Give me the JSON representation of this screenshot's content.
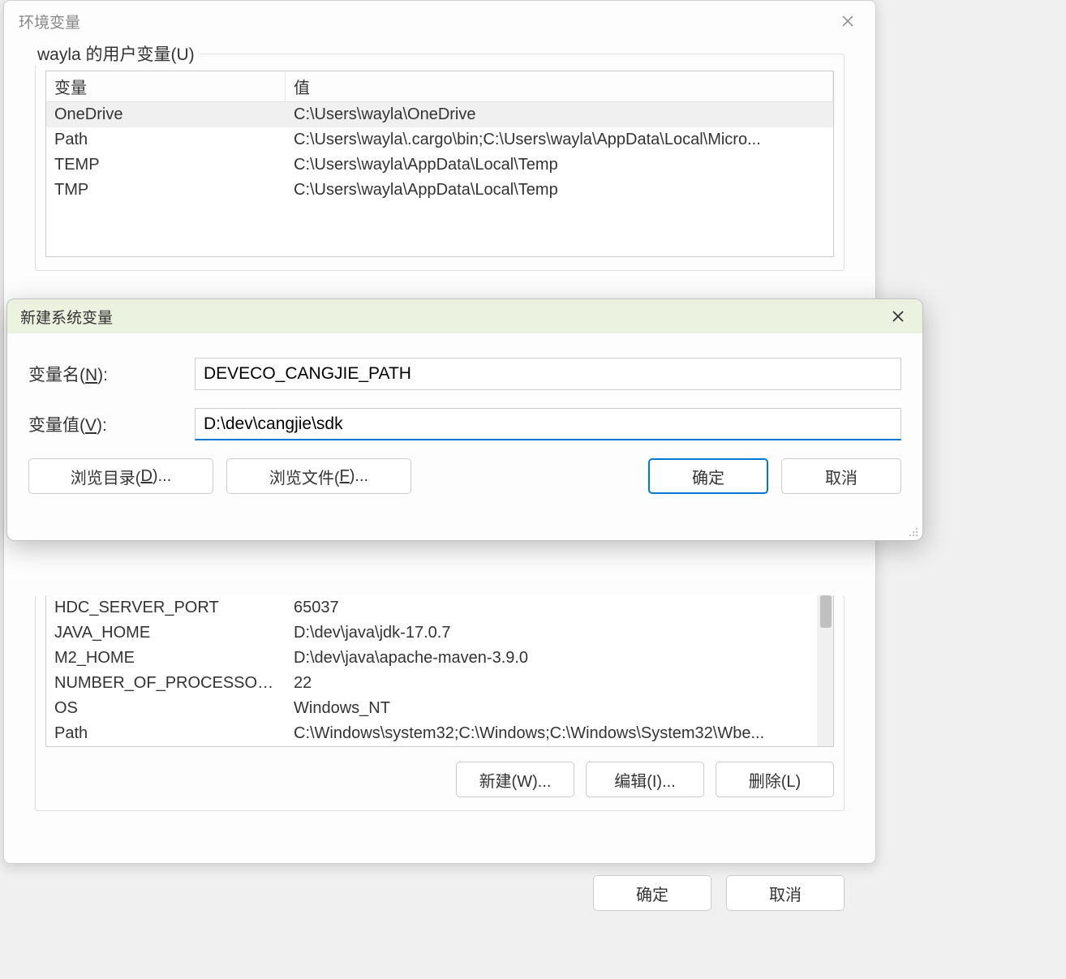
{
  "env_dialog": {
    "title": "环境变量",
    "user_vars_legend": "wayla 的用户变量(U)",
    "columns": {
      "variable": "变量",
      "value": "值"
    },
    "user_vars": [
      {
        "name": "OneDrive",
        "value": "C:\\Users\\wayla\\OneDrive"
      },
      {
        "name": "Path",
        "value": "C:\\Users\\wayla\\.cargo\\bin;C:\\Users\\wayla\\AppData\\Local\\Micro..."
      },
      {
        "name": "TEMP",
        "value": "C:\\Users\\wayla\\AppData\\Local\\Temp"
      },
      {
        "name": "TMP",
        "value": "C:\\Users\\wayla\\AppData\\Local\\Temp"
      }
    ],
    "system_vars_visible": [
      {
        "name": "HDC_SERVER_PORT",
        "value": "65037"
      },
      {
        "name": "JAVA_HOME",
        "value": "D:\\dev\\java\\jdk-17.0.7"
      },
      {
        "name": "M2_HOME",
        "value": "D:\\dev\\java\\apache-maven-3.9.0"
      },
      {
        "name": "NUMBER_OF_PROCESSORS",
        "value": "22"
      },
      {
        "name": "OS",
        "value": "Windows_NT"
      },
      {
        "name": "Path",
        "value": "C:\\Windows\\system32;C:\\Windows;C:\\Windows\\System32\\Wbe..."
      }
    ],
    "buttons": {
      "new": "新建(W)...",
      "edit": "编辑(I)...",
      "delete": "删除(L)",
      "ok": "确定",
      "cancel": "取消"
    }
  },
  "new_var_modal": {
    "title": "新建系统变量",
    "name_label": "变量名(N):",
    "name_value": "DEVECO_CANGJIE_PATH",
    "value_label": "变量值(V):",
    "value_value": "D:\\dev\\cangjie\\sdk",
    "buttons": {
      "browse_dir": "浏览目录(D)...",
      "browse_file": "浏览文件(F)...",
      "ok": "确定",
      "cancel": "取消"
    }
  }
}
